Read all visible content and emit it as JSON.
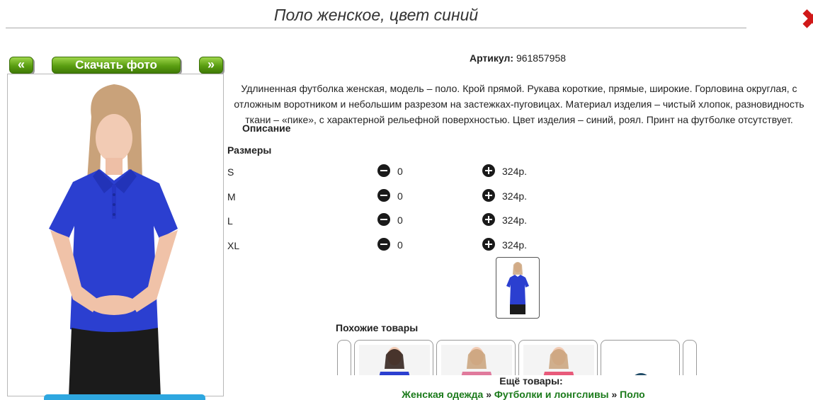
{
  "product": {
    "title": "Поло женское, цвет синий",
    "article_label": "Артикул:",
    "article_value": "961857958",
    "description": "Удлиненная футболка женская, модель – поло. Крой прямой. Рукава короткие, прямые, широкие. Горловина округлая, с отложным воротником и небольшим разрезом на застежках-пуговицах. Материал изделия – чистый хлопок, разновидность ткани – «пике», с характерной рельефной поверхностью. Цвет изделия – синий, роял. Принт на футболке отсутствует.",
    "description_label": "Описание",
    "shirt_color": "#2b3fd0"
  },
  "nav": {
    "prev_label": "«",
    "download_label": "Скачать фото",
    "next_label": "»"
  },
  "close_icon": "close-x-icon",
  "sizes": {
    "label": "Размеры",
    "rows": [
      {
        "size": "S",
        "qty": "0",
        "price": "324р."
      },
      {
        "size": "M",
        "qty": "0",
        "price": "324р."
      },
      {
        "size": "L",
        "qty": "0",
        "price": "324р."
      },
      {
        "size": "XL",
        "qty": "0",
        "price": "324р."
      }
    ]
  },
  "similar": {
    "label": "Похожие товары"
  },
  "more": {
    "label": "Ещё товары:",
    "crumbs": [
      "Женская одежда",
      "Футболки и лонгсливы",
      "Поло"
    ],
    "separator": "»"
  },
  "colors": {
    "green_button": "#5a9e12",
    "link_green": "#1a7a1a",
    "close_red": "#d01818",
    "accent_blue": "#2ea7e0"
  }
}
